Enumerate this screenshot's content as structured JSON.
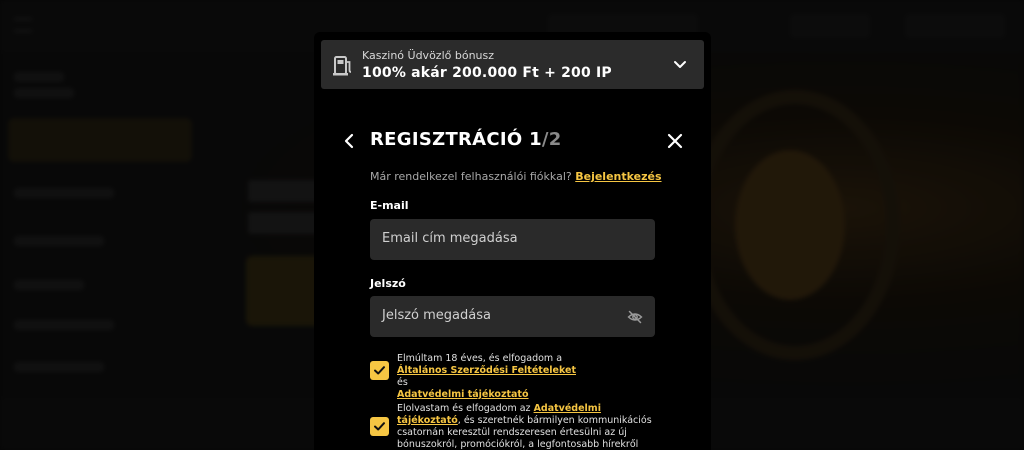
{
  "bonus": {
    "subtitle": "Kaszinó Üdvözlő bónusz",
    "headline": "100% akár 200.000 Ft + 200 IP"
  },
  "header": {
    "title_main": "REGISZTRÁCIÓ 1",
    "title_total": "/2"
  },
  "login": {
    "question": "Már rendelkezel felhasználói fiókkal?",
    "link": "Bejelentkezés"
  },
  "email": {
    "label": "E-mail",
    "placeholder": "Email cím megadása"
  },
  "password": {
    "label": "Jelszó",
    "placeholder": "Jelszó megadása"
  },
  "consent_terms": {
    "checked": true,
    "text_1": "Elmúltam 18 éves, és elfogadom a",
    "link_terms": "Általános Szerződési Feltételeket",
    "text_2": " és",
    "link_privacy": "Adatvédelmi tájékoztató"
  },
  "consent_marketing": {
    "checked": true,
    "text_1": "Elolvastam és elfogadom az ",
    "link_privacy": "Adatvédelmi tájékoztató",
    "text_2": ", és szeretnék bármilyen kommunikációs csatornán keresztül rendszeresen értesülni az új bónuszokról, promóciókról, a legfontosabb hírekről vagy egyéb fontos információkról."
  },
  "colors": {
    "accent": "#f6c643",
    "modal_bg": "#000000",
    "field_bg": "#2a2a2a"
  },
  "icons": {
    "bonus": "fuel-pump-icon",
    "expand": "chevron-down-icon",
    "back": "chevron-left-icon",
    "close": "close-icon",
    "password_toggle": "eye-off-icon",
    "checkbox": "check-icon"
  }
}
